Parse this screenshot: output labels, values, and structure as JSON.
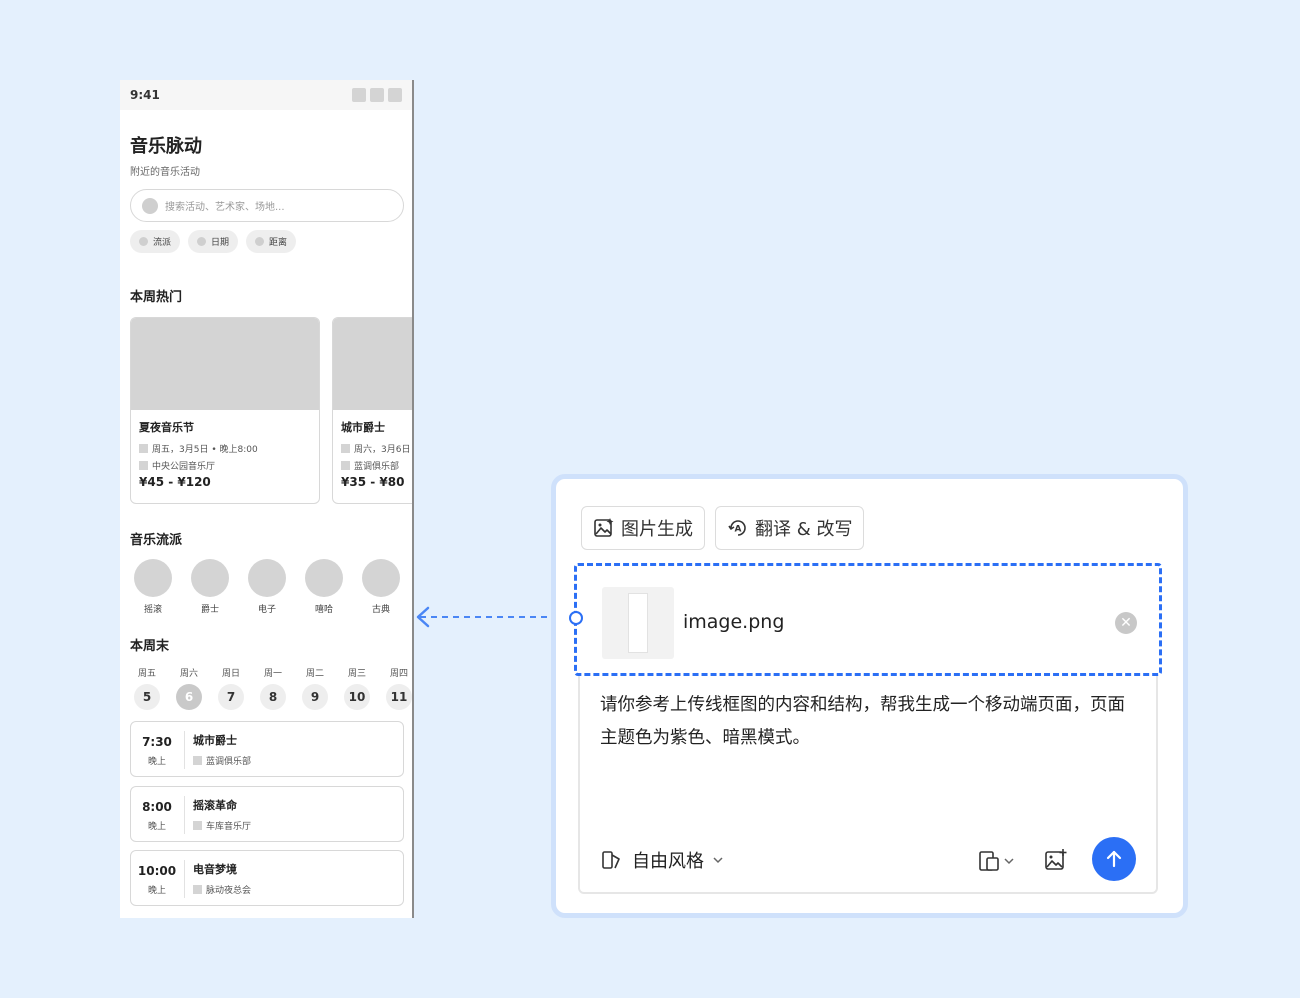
{
  "phone": {
    "status_time": "9:41",
    "title": "音乐脉动",
    "subtitle": "附近的音乐活动",
    "search_placeholder": "搜索活动、艺术家、场地...",
    "filters": [
      "流派",
      "日期",
      "距离"
    ],
    "hot_section_title": "本周热门",
    "hot_events": [
      {
        "name": "夏夜音乐节",
        "date": "周五，3月5日 • 晚上8:00",
        "venue": "中央公园音乐厅",
        "price": "¥45 - ¥120"
      },
      {
        "name": "城市爵士",
        "date": "周六，3月6日",
        "venue": "蓝调俱乐部",
        "price": "¥35 - ¥80"
      }
    ],
    "genre_section_title": "音乐流派",
    "genres": [
      "摇滚",
      "爵士",
      "电子",
      "嘻哈",
      "古典"
    ],
    "weekend_section_title": "本周末",
    "days": [
      {
        "weekday": "周五",
        "date": "5"
      },
      {
        "weekday": "周六",
        "date": "6"
      },
      {
        "weekday": "周日",
        "date": "7"
      },
      {
        "weekday": "周一",
        "date": "8"
      },
      {
        "weekday": "周二",
        "date": "9"
      },
      {
        "weekday": "周三",
        "date": "10"
      },
      {
        "weekday": "周四",
        "date": "11"
      }
    ],
    "selected_day_index": 1,
    "events": [
      {
        "time": "7:30",
        "period": "晚上",
        "name": "城市爵士",
        "venue": "蓝调俱乐部"
      },
      {
        "time": "8:00",
        "period": "晚上",
        "name": "摇滚革命",
        "venue": "车库音乐厅"
      },
      {
        "time": "10:00",
        "period": "晚上",
        "name": "电音梦境",
        "venue": "脉动夜总会"
      }
    ]
  },
  "composer": {
    "tool_image_gen": "图片生成",
    "tool_translate": "翻译 & 改写",
    "attachment_name": "image.png",
    "prompt_text": "请你参考上传线框图的内容和结构，帮我生成一个移动端页面，页面主题色为紫色、暗黑模式。",
    "style_label": "自由风格",
    "icons": {
      "image_gen": "image-sparkle-icon",
      "translate": "translate-icon",
      "remove": "close-icon",
      "style": "style-icon",
      "device": "device-icon",
      "add_image": "image-add-icon",
      "send": "arrow-up-icon"
    }
  },
  "colors": {
    "background": "#e4f0fd",
    "accent": "#2b6ff5",
    "panel_border": "#cfe1fb",
    "wireframe_gray": "#d4d4d4"
  }
}
